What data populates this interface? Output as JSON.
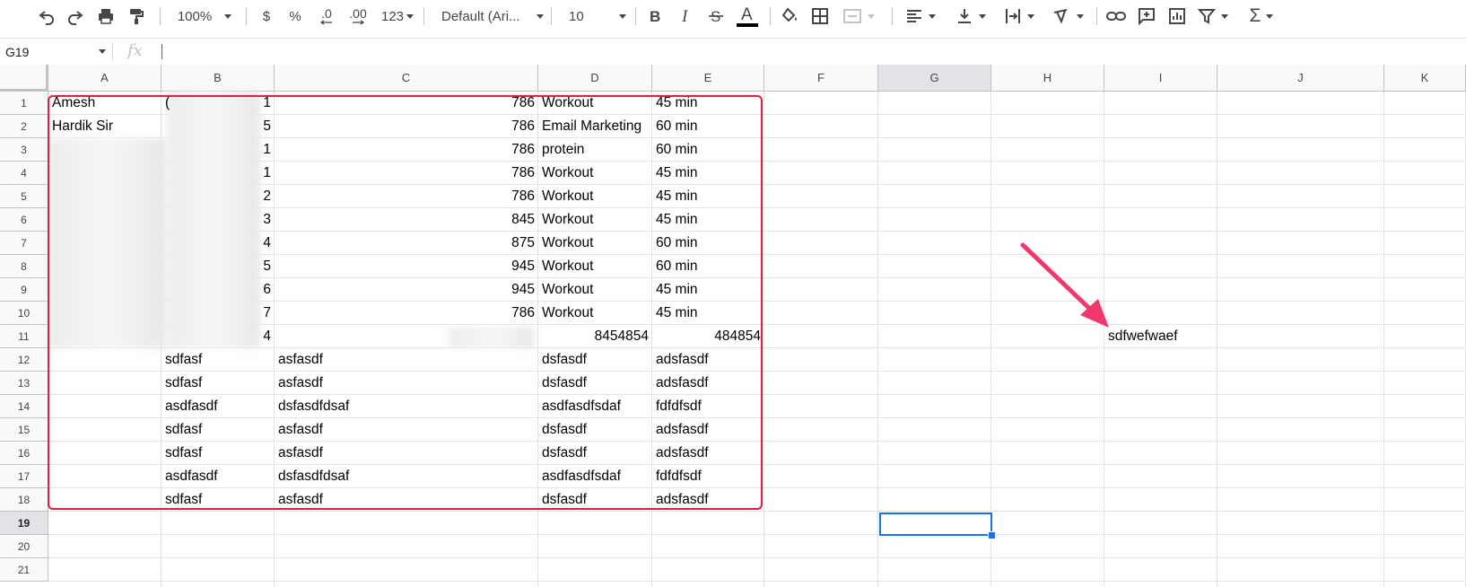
{
  "toolbar": {
    "zoom": "100%",
    "currency": "$",
    "percent": "%",
    "decrease_decimals": ".0",
    "increase_decimals": ".00",
    "more_formats": "123",
    "font": "Default (Ari...",
    "font_size": "10",
    "text_color": "#000000"
  },
  "formula_bar": {
    "name_box": "G19",
    "fx": "fx",
    "value": ""
  },
  "columns": [
    "A",
    "B",
    "C",
    "D",
    "E",
    "F",
    "G",
    "H",
    "I",
    "J",
    "K"
  ],
  "rows": [
    "1",
    "2",
    "3",
    "4",
    "5",
    "6",
    "7",
    "8",
    "9",
    "10",
    "11",
    "12",
    "13",
    "14",
    "15",
    "16",
    "17",
    "18",
    "19",
    "20",
    "21"
  ],
  "selected": {
    "column": "G",
    "row": "19"
  },
  "cells": {
    "A1": "Amesh",
    "B1": "(",
    "B1b": "1",
    "C1": "786",
    "D1": "Workout",
    "E1": "45 min",
    "A2": "Hardik Sir",
    "B2": "5",
    "C2": "786",
    "D2": "Email Marketing",
    "E2": "60 min",
    "B3": "1",
    "C3": "786",
    "D3": "protein",
    "E3": "60 min",
    "B4": "1",
    "C4": "786",
    "D4": "Workout",
    "E4": "45 min",
    "B5": "2",
    "C5": "786",
    "D5": "Workout",
    "E5": "45 min",
    "B6": "3",
    "C6": "845",
    "D6": "Workout",
    "E6": "45 min",
    "B7": "4",
    "C7": "875",
    "D7": "Workout",
    "E7": "60 min",
    "B8": "5",
    "C8": "945",
    "D8": "Workout",
    "E8": "60 min",
    "B9": "6",
    "C9": "945",
    "D9": "Workout",
    "E9": "45 min",
    "B10": "7",
    "C10": "786",
    "D10": "Workout",
    "E10": "45 min",
    "B11": "4",
    "D11": "8454854",
    "E11": "484854",
    "I11": "sdfwefwaef",
    "B12": "sdfasf",
    "C12": "asfasdf",
    "D12": "dsfasdf",
    "E12": "adsfasdf",
    "B13": "sdfasf",
    "C13": "asfasdf",
    "D13": "dsfasdf",
    "E13": "adsfasdf",
    "B14": "asdfasdf",
    "C14": "dsfasdfdsaf",
    "D14": "asdfasdfsdaf",
    "E14": "fdfdfsdf",
    "B15": "sdfasf",
    "C15": "asfasdf",
    "D15": "dsfasdf",
    "E15": "adsfasdf",
    "B16": "sdfasf",
    "C16": "asfasdf",
    "D16": "dsfasdf",
    "E16": "adsfasdf",
    "B17": "asdfasdf",
    "C17": "dsfasdfdsaf",
    "D17": "asdfasdfsdaf",
    "E17": "fdfdfsdf",
    "B18": "sdfasf",
    "C18": "asfasdf",
    "D18": "dsfasdf",
    "E18": "adsfasdf"
  },
  "annotations": {
    "outline_color": "#e51c3a",
    "arrow_color": "#f0386b"
  }
}
